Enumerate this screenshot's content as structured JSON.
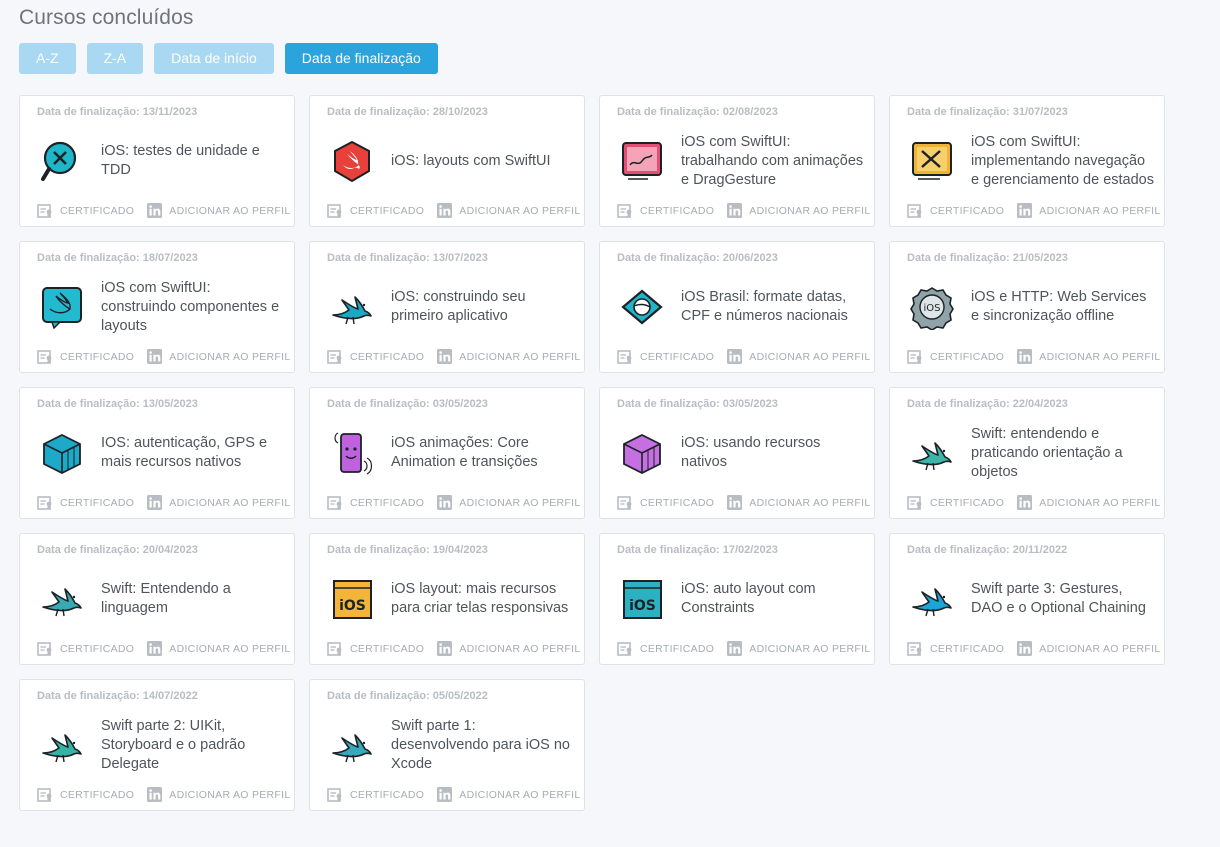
{
  "page_title": "Cursos concluídos",
  "sort_buttons": [
    {
      "label": "A-Z",
      "active": false
    },
    {
      "label": "Z-A",
      "active": false
    },
    {
      "label": "Data de início",
      "active": false
    },
    {
      "label": "Data de finalização",
      "active": true
    }
  ],
  "labels": {
    "certificate": "CERTIFICADO",
    "add_profile": "ADICIONAR AO PERFIL"
  },
  "courses": [
    {
      "date": "Data de finalização: 13/11/2023",
      "title": "iOS: testes de unidade e TDD",
      "icon": "magnifier-bug-icon",
      "color": "#1fb6c9"
    },
    {
      "date": "Data de finalização: 28/10/2023",
      "title": "iOS: layouts com SwiftUI",
      "icon": "swift-hexagon-icon",
      "color": "#e8403b"
    },
    {
      "date": "Data de finalização: 02/08/2023",
      "title": "iOS com SwiftUI: trabalhando com animações e DragGesture",
      "icon": "tablet-drawing-icon",
      "color": "#e34f74"
    },
    {
      "date": "Data de finalização: 31/07/2023",
      "title": "iOS com SwiftUI: implementando navegação e gerenciamento de estados",
      "icon": "tablet-tools-icon",
      "color": "#f0b433"
    },
    {
      "date": "Data de finalização: 18/07/2023",
      "title": "iOS com SwiftUI: construindo componentes e layouts",
      "icon": "swift-screen-icon",
      "color": "#23b9cf"
    },
    {
      "date": "Data de finalização: 13/07/2023",
      "title": "iOS: construindo seu primeiro aplicativo",
      "icon": "swift-bird-icon",
      "color": "#1aa8c4"
    },
    {
      "date": "Data de finalização: 20/06/2023",
      "title": "iOS Brasil: formate datas, CPF e números nacionais",
      "icon": "brazil-flag-icon",
      "color": "#22b3c6"
    },
    {
      "date": "Data de finalização: 21/05/2023",
      "title": "iOS e HTTP: Web Services e sincronização offline",
      "icon": "ios-badge-icon",
      "color": "#8fa3a8"
    },
    {
      "date": "Data de finalização: 13/05/2023",
      "title": "IOS: autenticação, GPS e mais recursos nativos",
      "icon": "cube-icon",
      "color": "#1ea9c9"
    },
    {
      "date": "Data de finalização: 03/05/2023",
      "title": "iOS animações: Core Animation e transições",
      "icon": "phone-animation-icon",
      "color": "#c061e0"
    },
    {
      "date": "Data de finalização: 03/05/2023",
      "title": "iOS: usando recursos nativos",
      "icon": "cube-icon",
      "color": "#c66fe3"
    },
    {
      "date": "Data de finalização: 22/04/2023",
      "title": "Swift: entendendo e praticando orientação a objetos",
      "icon": "swift-bird-icon",
      "color": "#3cb6a8"
    },
    {
      "date": "Data de finalização: 20/04/2023",
      "title": "Swift: Entendendo a linguagem",
      "icon": "swift-bird-icon",
      "color": "#3aa9b4"
    },
    {
      "date": "Data de finalização: 19/04/2023",
      "title": "iOS layout: mais recursos para criar telas responsivas",
      "icon": "ios-window-icon",
      "color": "#f3b43a"
    },
    {
      "date": "Data de finalização: 17/02/2023",
      "title": "iOS: auto layout com Constraints",
      "icon": "ios-window-icon",
      "color": "#2cb1c3"
    },
    {
      "date": "Data de finalização: 20/11/2022",
      "title": "Swift parte 3: Gestures, DAO e o Optional Chaining",
      "icon": "swift-bird-icon",
      "color": "#1aa6d6"
    },
    {
      "date": "Data de finalização: 14/07/2022",
      "title": "Swift parte 2: UIKit, Storyboard e o padrão Delegate",
      "icon": "swift-bird-icon",
      "color": "#36b3a4"
    },
    {
      "date": "Data de finalização: 05/05/2022",
      "title": "Swift parte 1: desenvolvendo para iOS no Xcode",
      "icon": "swift-bird-icon",
      "color": "#37a8bd"
    }
  ]
}
